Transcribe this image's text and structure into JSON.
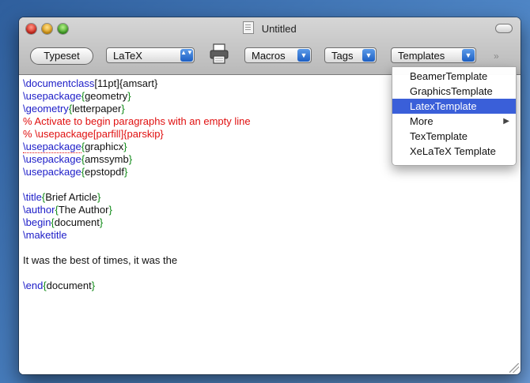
{
  "window": {
    "title": "Untitled"
  },
  "toolbar": {
    "typeset_label": "Typeset",
    "format_value": "LaTeX",
    "macros_label": "Macros",
    "tags_label": "Tags",
    "templates_label": "Templates",
    "overflow_icon": "»",
    "arrow_down": "▼",
    "arrow_updown": "▲▼"
  },
  "editor": {
    "lines": [
      {
        "cmd": "\\documentclass",
        "rest": "[11pt]{amsart}"
      },
      {
        "cmd": "\\usepackage",
        "open": "{",
        "arg": "geometry",
        "close": "}"
      },
      {
        "cmd": "\\geometry",
        "open": "{",
        "arg": "letterpaper",
        "close": "}"
      },
      {
        "comment": "% Activate to begin paragraphs with an empty line"
      },
      {
        "comment": "% \\usepackage[parfill]{parskip}"
      },
      {
        "cmd": "\\usepackage",
        "open": "{",
        "arg": "graphicx",
        "close": "}"
      },
      {
        "cmd": "\\usepackage",
        "open": "{",
        "arg": "amssymb",
        "close": "}"
      },
      {
        "cmd": "\\usepackage",
        "open": "{",
        "arg": "epstopdf",
        "close": "}"
      },
      {
        "cmd": "\\title",
        "open": "{",
        "arg": "Brief Article",
        "close": "}"
      },
      {
        "cmd": "\\author",
        "open": "{",
        "arg": "The Author",
        "close": "}"
      },
      {
        "cmd": "\\begin",
        "open": "{",
        "arg": "document",
        "close": "}"
      },
      {
        "cmd": "\\maketitle"
      },
      {
        "text": "It was the best of times, it was the"
      },
      {
        "cmd": "\\end",
        "open": "{",
        "arg": "document",
        "close": "}"
      }
    ]
  },
  "templates_menu": {
    "items": [
      {
        "label": "BeamerTemplate",
        "selected": false
      },
      {
        "label": "GraphicsTemplate",
        "selected": false
      },
      {
        "label": "LatexTemplate",
        "selected": true
      },
      {
        "label": "More",
        "selected": false,
        "submenu_icon": "▶"
      },
      {
        "label": "TexTemplate",
        "selected": false
      },
      {
        "label": "XeLaTeX Template",
        "selected": false
      }
    ]
  }
}
